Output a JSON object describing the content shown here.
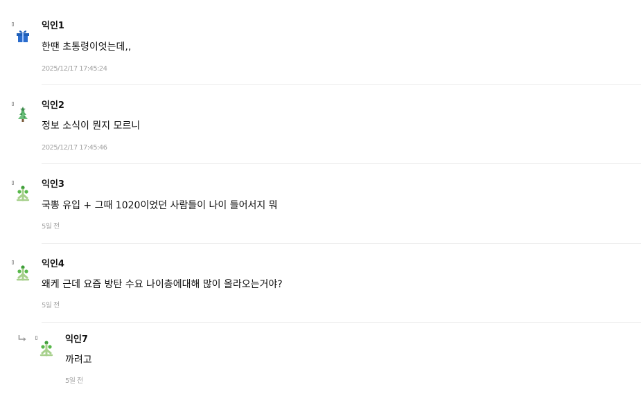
{
  "comments": [
    {
      "author": "익인1",
      "text": "한땐 초통령이엇는데,,",
      "time": "2025/12/17 17:45:24",
      "avatar": "gift-icon"
    },
    {
      "author": "익인2",
      "text": "정보 소식이 뭔지 모르니",
      "time": "2025/12/17 17:45:46",
      "avatar": "christmas-tree-icon"
    },
    {
      "author": "익인3",
      "text": "국뽕 유입 + 그때 1020이었던 사람들이 나이 들어서지 뭐",
      "time": "5일 전",
      "avatar": "sprout-icon"
    },
    {
      "author": "익인4",
      "text": "왜케 근데 요즘 방탄 수요 나이층에대해 많이 올라오는거야?",
      "time": "5일 전",
      "avatar": "sprout-icon"
    }
  ],
  "replies": [
    {
      "author": "익인7",
      "text": "까려고",
      "time": "5일 전",
      "avatar": "sprout-icon"
    }
  ],
  "colors": {
    "text": "#111111",
    "timestamp": "#a3a3a3",
    "divider": "#ebebeb",
    "gift_blue": "#1f5fb8",
    "tree_green": "#58b26a",
    "sprout_green": "#6fae3a"
  }
}
